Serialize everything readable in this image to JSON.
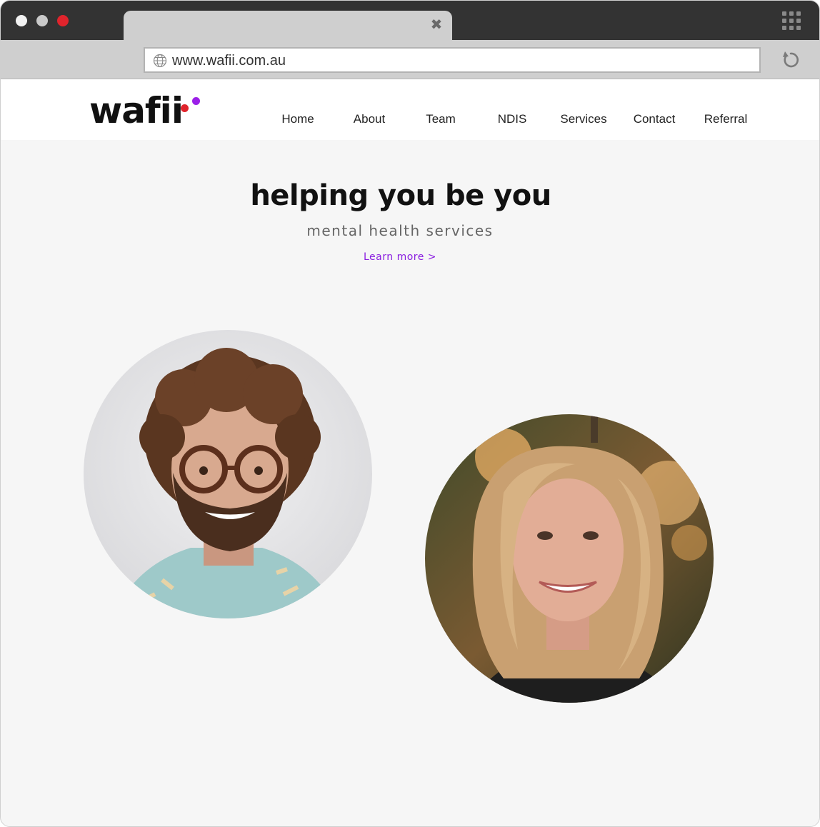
{
  "browser": {
    "url": "www.wafii.com.au",
    "close_glyph": "✖"
  },
  "logo": {
    "text": "wafii",
    "dot_colors": [
      "#e0242c",
      "#9b1fe8"
    ]
  },
  "nav": {
    "items": [
      {
        "label": "Home"
      },
      {
        "label": "About"
      },
      {
        "label": "Team"
      },
      {
        "label": "NDIS"
      },
      {
        "label": "Services"
      },
      {
        "label": "Contact"
      },
      {
        "label": "Referral"
      }
    ]
  },
  "hero": {
    "title": "helping you be you",
    "subtitle": "mental health services",
    "cta": "Learn more >"
  },
  "colors": {
    "accent": "#8a1ee0",
    "page_bg": "#f6f6f6"
  }
}
